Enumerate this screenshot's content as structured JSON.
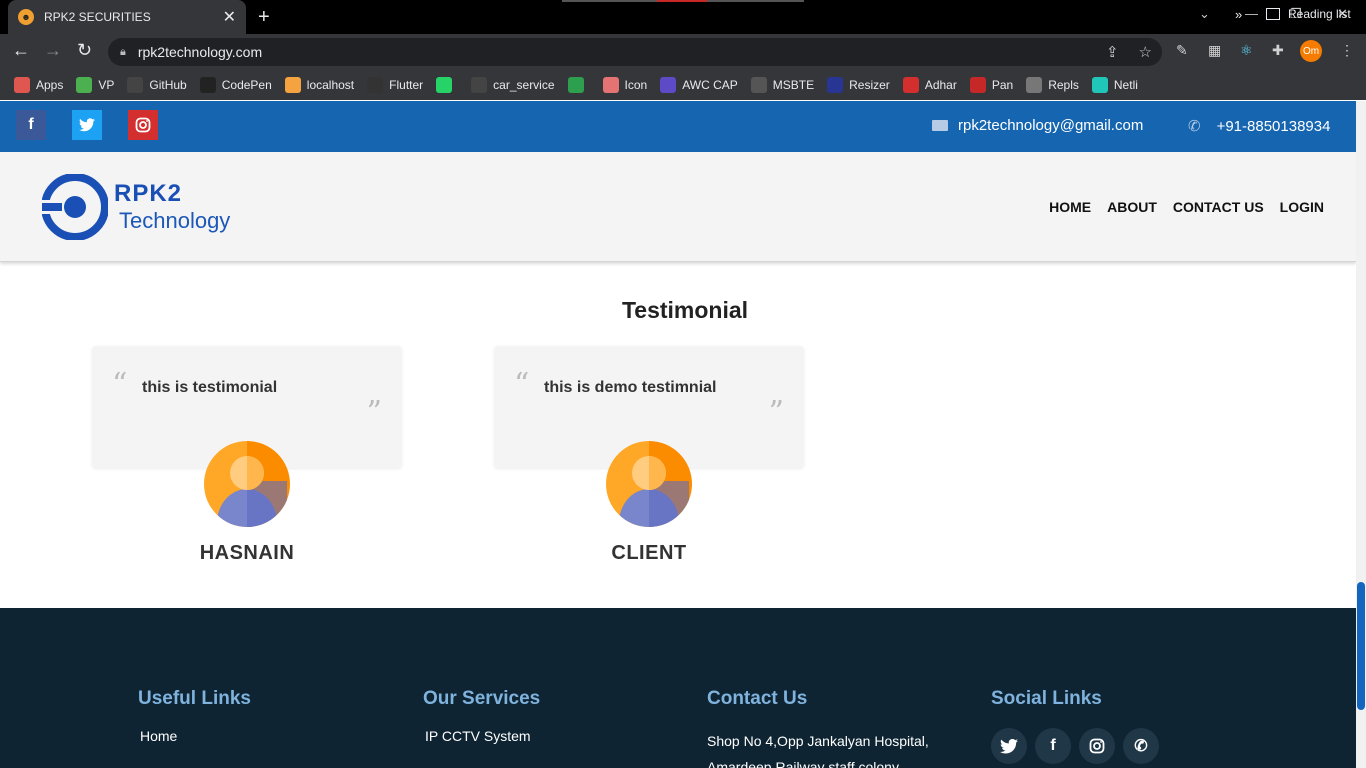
{
  "browser": {
    "tab_title": "RPK2 SECURITIES",
    "url": "rpk2technology.com",
    "profile_initials": "Om",
    "bookmarks": [
      {
        "label": "Apps",
        "color": "#e0574f"
      },
      {
        "label": "VP",
        "color": "#4caf50"
      },
      {
        "label": "GitHub",
        "color": "#444"
      },
      {
        "label": "CodePen",
        "color": "#222"
      },
      {
        "label": "localhost",
        "color": "#f4a340"
      },
      {
        "label": "Flutter",
        "color": "#333"
      },
      {
        "label": "",
        "color": "#25d366"
      },
      {
        "label": "car_service",
        "color": "#444"
      },
      {
        "label": "",
        "color": "#2e9e4f"
      },
      {
        "label": "Icon",
        "color": "#e57373"
      },
      {
        "label": "AWC CAP",
        "color": "#5c4ac7"
      },
      {
        "label": "MSBTE",
        "color": "#555"
      },
      {
        "label": "Resizer",
        "color": "#283593"
      },
      {
        "label": "Adhar",
        "color": "#d32f2f"
      },
      {
        "label": "Pan",
        "color": "#c62828"
      },
      {
        "label": "Repls",
        "color": "#777"
      },
      {
        "label": "Netli",
        "color": "#20c6b7"
      }
    ],
    "reading_list": "Reading list"
  },
  "topbar": {
    "email": "rpk2technology@gmail.com",
    "phone": "+91-8850138934"
  },
  "logo": {
    "line1": "RPK2",
    "line2": "Technology"
  },
  "nav": {
    "home": "HOME",
    "about": "ABOUT",
    "contact": "CONTACT US",
    "login": "LOGIN"
  },
  "testimonial": {
    "title": "Testimonial",
    "items": [
      {
        "text": "this is testimonial",
        "name": "HASNAIN"
      },
      {
        "text": "this is demo testimnial",
        "name": "CLIENT"
      }
    ]
  },
  "footer": {
    "useful_links": {
      "heading": "Useful Links",
      "first": "Home"
    },
    "services": {
      "heading": "Our Services",
      "first": "IP CCTV System"
    },
    "contact": {
      "heading": "Contact Us",
      "line1": "Shop No 4,Opp Jankalyan Hospital,",
      "line2": "Amardeep Railway staff colony,"
    },
    "social": {
      "heading": "Social Links"
    }
  },
  "colors": {
    "topstrip": "#1565b0",
    "footer": "#0e2432",
    "accent_blue": "#1a4fb5"
  }
}
